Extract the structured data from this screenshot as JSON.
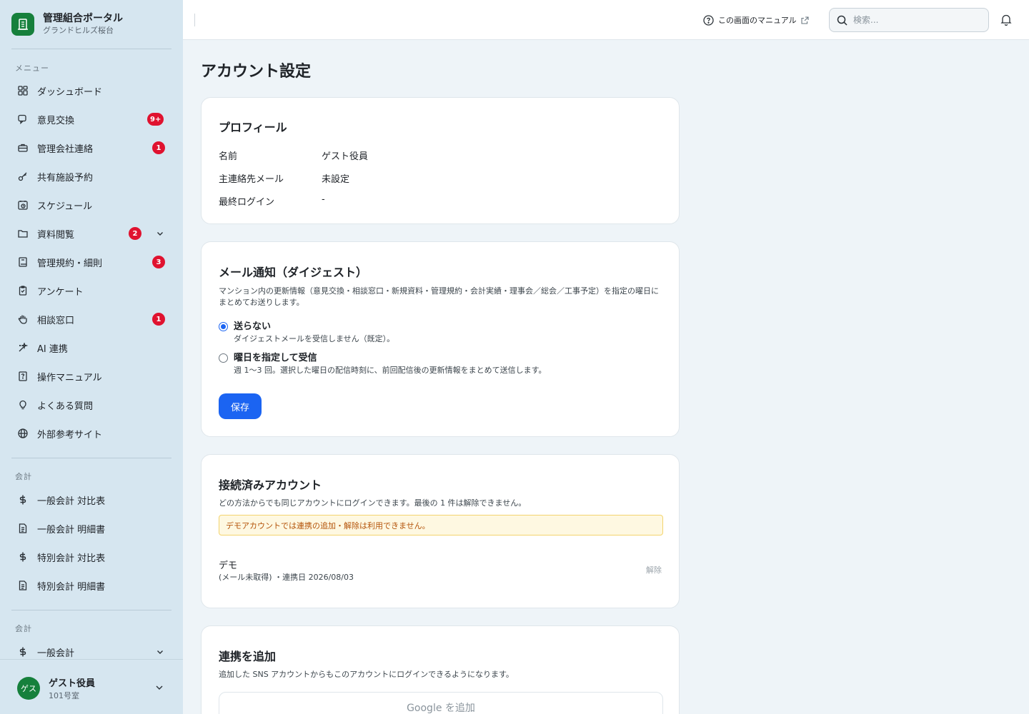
{
  "brand": {
    "title": "管理組合ポータル",
    "subtitle": "グランドヒルズ桜台"
  },
  "sidebar": {
    "menu_label": "メニュー",
    "items": [
      {
        "label": "ダッシュボード",
        "icon": "dashboard-icon"
      },
      {
        "label": "意見交換",
        "icon": "chat-icon",
        "badge": "9+"
      },
      {
        "label": "管理会社連絡",
        "icon": "briefcase-icon",
        "badge": "1"
      },
      {
        "label": "共有施設予約",
        "icon": "key-icon"
      },
      {
        "label": "スケジュール",
        "icon": "calendar-clock-icon"
      },
      {
        "label": "資料閲覧",
        "icon": "folder-icon",
        "badge": "2",
        "expandable": true
      },
      {
        "label": "管理規約・細則",
        "icon": "book-icon",
        "badge": "3"
      },
      {
        "label": "アンケート",
        "icon": "clipboard-icon"
      },
      {
        "label": "相談窓口",
        "icon": "hand-icon",
        "badge": "1"
      },
      {
        "label": "AI 連携",
        "icon": "sparkle-icon"
      },
      {
        "label": "操作マニュアル",
        "icon": "manual-icon"
      },
      {
        "label": "よくある質問",
        "icon": "lightbulb-icon"
      },
      {
        "label": "外部参考サイト",
        "icon": "globe-icon"
      }
    ],
    "accounting_label": "会計",
    "accounting_items": [
      {
        "label": "一般会計 対比表",
        "icon": "dollar-icon"
      },
      {
        "label": "一般会計 明細書",
        "icon": "document-icon"
      },
      {
        "label": "特別会計 対比表",
        "icon": "dollar-icon"
      },
      {
        "label": "特別会計 明細書",
        "icon": "document-icon"
      }
    ],
    "accounting_label2": "会計",
    "accounting_items2": [
      {
        "label": "一般会計",
        "icon": "dollar-icon",
        "expandable": true
      }
    ]
  },
  "user": {
    "avatar": "ゲス",
    "name": "ゲスト役員",
    "room": "101号室"
  },
  "topbar": {
    "manual_label": "この画面のマニュアル",
    "search_placeholder": "検索..."
  },
  "main": {
    "title": "アカウント設定",
    "profile": {
      "title": "プロフィール",
      "rows": [
        {
          "key": "名前",
          "value": "ゲスト役員"
        },
        {
          "key": "主連絡先メール",
          "value": "未設定"
        },
        {
          "key": "最終ログイン",
          "value": "-"
        }
      ]
    },
    "digest": {
      "title": "メール通知（ダイジェスト）",
      "description": "マンション内の更新情報（意見交換・相談窓口・新規資料・管理規約・会計実績・理事会／総会／工事予定）を指定の曜日にまとめてお送りします。",
      "options": [
        {
          "label": "送らない",
          "help": "ダイジェストメールを受信しません（既定）。",
          "checked": true
        },
        {
          "label": "曜日を指定して受信",
          "help": "週 1〜3 回。選択した曜日の配信時刻に、前回配信後の更新情報をまとめて送信します。",
          "checked": false
        }
      ],
      "save_label": "保存"
    },
    "connected": {
      "title": "接続済みアカウント",
      "description": "どの方法からでも同じアカウントにログインできます。最後の 1 件は解除できません。",
      "warning": "デモアカウントでは連携の追加・解除は利用できません。",
      "account_name": "デモ",
      "account_meta": "(メール未取得) ・連携日 2026/08/03",
      "unlink_label": "解除"
    },
    "add_link": {
      "title": "連携を追加",
      "description": "追加した SNS アカウントからもこのアカウントにログインできるようになります。",
      "google_label": "Google を追加"
    }
  },
  "colors": {
    "brand": "#16803c",
    "accent": "#1b64f2",
    "badge": "#e0122f",
    "sidebar_bg": "#d6e6f0",
    "page_bg": "#eef4f8"
  }
}
